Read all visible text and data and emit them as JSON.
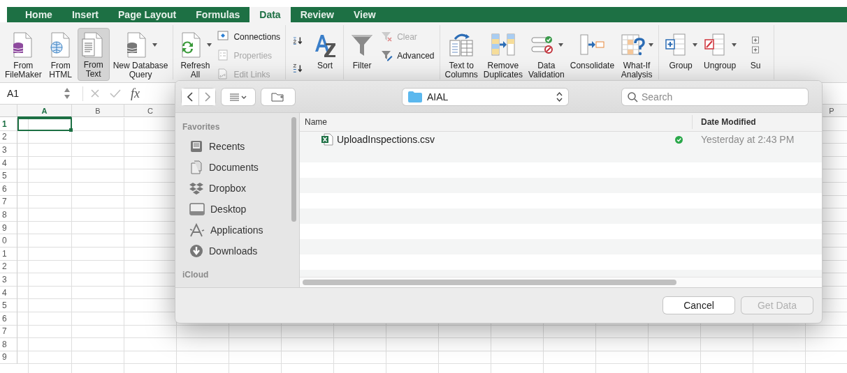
{
  "ribbon_tabs": [
    {
      "label": "Home",
      "selected": false
    },
    {
      "label": "Insert",
      "selected": false
    },
    {
      "label": "Page Layout",
      "selected": false
    },
    {
      "label": "Formulas",
      "selected": false
    },
    {
      "label": "Data",
      "selected": true
    },
    {
      "label": "Review",
      "selected": false
    },
    {
      "label": "View",
      "selected": false
    }
  ],
  "ribbon": {
    "groups": [
      {
        "items": [
          {
            "kind": "large",
            "label": "From\nFileMaker",
            "dropdown": false,
            "pressed": false
          },
          {
            "kind": "large",
            "label": "From\nHTML",
            "dropdown": false,
            "pressed": false
          },
          {
            "kind": "large",
            "label": "From\nText",
            "dropdown": false,
            "pressed": true
          },
          {
            "kind": "large",
            "label": "New Database\nQuery",
            "dropdown": true,
            "pressed": false
          }
        ]
      },
      {
        "items": [
          {
            "kind": "large",
            "label": "Refresh\nAll",
            "dropdown": true,
            "pressed": false
          },
          {
            "kind": "small",
            "label": "Connections",
            "disabled": false
          },
          {
            "kind": "small",
            "label": "Properties",
            "disabled": true
          },
          {
            "kind": "small",
            "label": "Edit Links",
            "disabled": true
          }
        ]
      },
      {
        "items": [
          {
            "kind": "icon"
          },
          {
            "kind": "icon"
          },
          {
            "kind": "large",
            "label": "Sort",
            "dropdown": false,
            "pressed": false
          }
        ]
      },
      {
        "items": [
          {
            "kind": "large",
            "label": "Filter",
            "dropdown": false,
            "pressed": false
          },
          {
            "kind": "small",
            "label": "Clear",
            "disabled": true
          },
          {
            "kind": "small",
            "label": "Advanced",
            "disabled": false
          }
        ]
      },
      {
        "items": [
          {
            "kind": "large",
            "label": "Text to\nColumns",
            "dropdown": false,
            "pressed": false
          },
          {
            "kind": "large",
            "label": "Remove\nDuplicates",
            "dropdown": false,
            "pressed": false
          },
          {
            "kind": "large",
            "label": "Data\nValidation",
            "dropdown": true,
            "pressed": false
          },
          {
            "kind": "large",
            "label": "Consolidate",
            "dropdown": false,
            "pressed": false
          },
          {
            "kind": "large",
            "label": "What-If\nAnalysis",
            "dropdown": true,
            "pressed": false
          }
        ]
      },
      {
        "items": [
          {
            "kind": "large",
            "label": "Group",
            "dropdown": true,
            "pressed": false
          },
          {
            "kind": "large",
            "label": "Ungroup",
            "dropdown": true,
            "pressed": false
          },
          {
            "kind": "large",
            "label": "Su",
            "dropdown": false,
            "pressed": false
          }
        ]
      }
    ]
  },
  "formula_bar": {
    "name_box": "A1",
    "function_label": "fx"
  },
  "sheet": {
    "columns": [
      {
        "label": "A",
        "selected": true
      },
      {
        "label": "B",
        "selected": false
      },
      {
        "label": "C",
        "selected": false
      }
    ],
    "far_column": "P",
    "rows": [
      {
        "label": "1",
        "selected": true
      },
      {
        "label": "2",
        "selected": false
      },
      {
        "label": "3",
        "selected": false
      },
      {
        "label": "4",
        "selected": false
      },
      {
        "label": "5",
        "selected": false
      },
      {
        "label": "6",
        "selected": false
      },
      {
        "label": "7",
        "selected": false
      },
      {
        "label": "8",
        "selected": false
      },
      {
        "label": "9",
        "selected": false
      },
      {
        "label": "0",
        "selected": false
      },
      {
        "label": "1",
        "selected": false
      },
      {
        "label": "2",
        "selected": false
      },
      {
        "label": "3",
        "selected": false
      },
      {
        "label": "4",
        "selected": false
      },
      {
        "label": "5",
        "selected": false
      },
      {
        "label": "6",
        "selected": false
      },
      {
        "label": "7",
        "selected": false
      },
      {
        "label": "8",
        "selected": false
      },
      {
        "label": "9",
        "selected": false
      }
    ]
  },
  "dialog": {
    "location": "AIAL",
    "search": {
      "placeholder": "Search"
    },
    "sidebar": [
      {
        "title": "Favorites",
        "items": [
          {
            "label": "Recents",
            "selected": false
          },
          {
            "label": "Documents",
            "selected": false
          },
          {
            "label": "Dropbox",
            "selected": false
          },
          {
            "label": "Desktop",
            "selected": false
          },
          {
            "label": "Applications",
            "selected": false
          },
          {
            "label": "Downloads",
            "selected": false
          }
        ]
      },
      {
        "title": "iCloud"
      }
    ],
    "columns": [
      "Name",
      "Date Modified"
    ],
    "files": [
      {
        "name": "UploadInspections.csv",
        "synced": true,
        "date": "Yesterday at 2:43 PM"
      }
    ],
    "buttons": [
      {
        "label": "Cancel",
        "disabled": false
      },
      {
        "label": "Get Data",
        "disabled": true
      }
    ]
  }
}
